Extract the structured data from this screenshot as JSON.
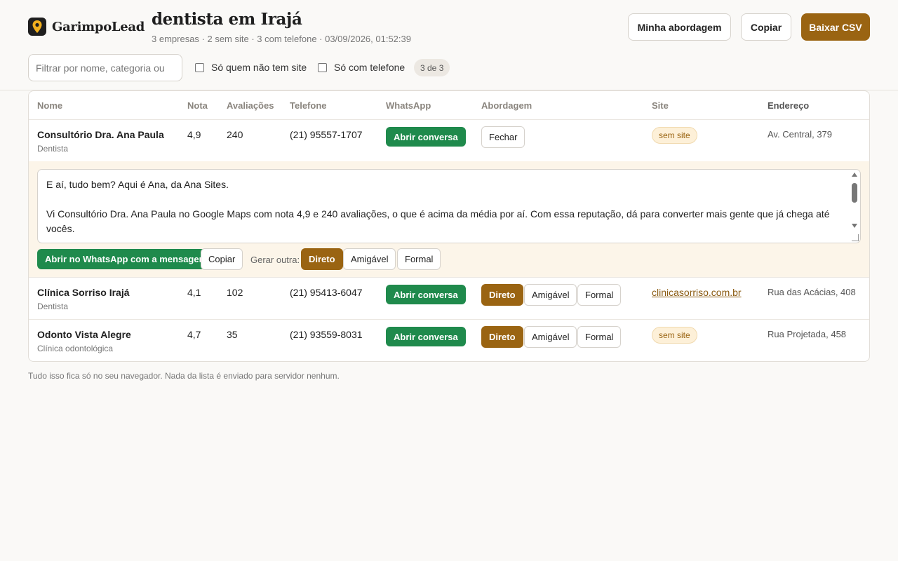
{
  "header": {
    "brand": "GarimpoLead",
    "title": "dentista em Irajá",
    "subtitle": "3 empresas · 2 sem site · 3 com telefone · 03/09/2026, 01:52:39",
    "buttons": {
      "approach": "Minha abordagem",
      "copy": "Copiar",
      "download": "Baixar CSV"
    }
  },
  "filters": {
    "search_placeholder": "Filtrar por nome, categoria ou",
    "no_site_label": "Só quem não tem site",
    "with_phone_label": "Só com telefone",
    "count": "3 de 3"
  },
  "table": {
    "columns": [
      "Nome",
      "Nota",
      "Avaliações",
      "Telefone",
      "WhatsApp",
      "Abordagem",
      "Site",
      "Endereço"
    ],
    "rows": [
      {
        "name": "Consultório Dra. Ana Paula",
        "category": "Dentista",
        "rating": "4,9",
        "reviews": "240",
        "phone": "(21) 95557-1707",
        "whatsapp": "Abrir conversa",
        "approach": "Fechar",
        "site": "sem site",
        "address": "Av. Central, 379"
      },
      {
        "name": "Clínica Sorriso Irajá",
        "category": "Dentista",
        "rating": "4,1",
        "reviews": "102",
        "phone": "(21) 95413-6047",
        "whatsapp": "Abrir conversa",
        "site": "clinicasorriso.com.br",
        "address": "Rua das Acácias, 408"
      },
      {
        "name": "Odonto Vista Alegre",
        "category": "Clínica odontológica",
        "rating": "4,7",
        "reviews": "35",
        "phone": "(21) 93559-8031",
        "whatsapp": "Abrir conversa",
        "site": "sem site",
        "address": "Rua Projetada, 458"
      }
    ],
    "tone_options": [
      "Direto",
      "Amigável",
      "Formal"
    ]
  },
  "expanded": {
    "message_line1": "E aí, tudo bem? Aqui é Ana, da Ana Sites.",
    "message_line2": "Vi Consultório Dra. Ana Paula no Google Maps com nota 4,9 e 240 avaliações, o que é acima da média por aí. Com essa reputação, dá para converter mais gente que já chega até vocês.",
    "open_whatsapp": "Abrir no WhatsApp com a mensagem",
    "copy": "Copiar",
    "generate_label": "Gerar outra:",
    "tones": [
      "Direto",
      "Amigável",
      "Formal"
    ],
    "active_tone": "Direto"
  },
  "footer": "Tudo isso fica só no seu navegador. Nada da lista é enviado para servidor nenhum.",
  "colors": {
    "accent": "#9a6412",
    "whatsapp": "#1f8a4c",
    "expand_bg": "#fcf5e9"
  },
  "icons": {
    "logo": "map-pin-icon"
  }
}
